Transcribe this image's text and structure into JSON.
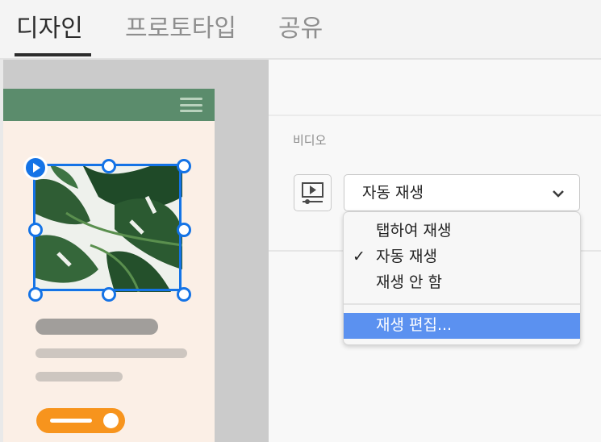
{
  "tabs": [
    {
      "label": "디자인",
      "active": true
    },
    {
      "label": "프로토타입",
      "active": false
    },
    {
      "label": "공유",
      "active": false
    }
  ],
  "panel": {
    "section_label": "비디오",
    "playback_select": {
      "value": "자동 재생"
    }
  },
  "menu": {
    "items": [
      {
        "label": "탭하여 재생",
        "checked": false
      },
      {
        "label": "자동 재생",
        "checked": true,
        "check_glyph": "✓"
      },
      {
        "label": "재생 안 함",
        "checked": false
      }
    ],
    "edit_item": {
      "label": "재생 편집...",
      "highlighted": true
    }
  },
  "icons": {
    "video_button": "video-playback-icon",
    "select_arrow": "chevron-down-icon",
    "artboard_menu": "hamburger-menu-icon",
    "video_badge": "play-icon"
  },
  "colors": {
    "accent": "#1473e6",
    "artboard_header": "#5b8c6c",
    "artboard_bg": "#fbefe6",
    "cta": "#f7941d",
    "menu_highlight": "#5b91f0"
  }
}
